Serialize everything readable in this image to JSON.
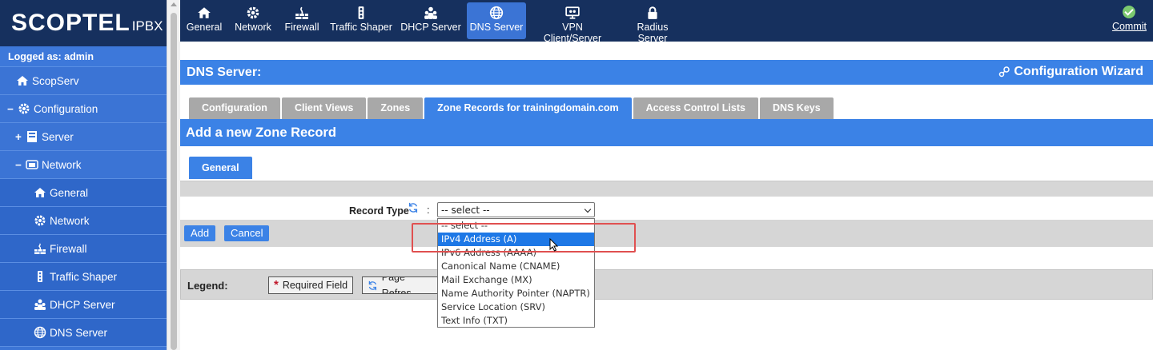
{
  "brand": {
    "name": "SCOPTEL",
    "suffix": "IPBX"
  },
  "sidebar": {
    "logged": "Logged as: admin",
    "items": [
      {
        "label": "ScopServ",
        "icon": "home-icon",
        "pm": ""
      },
      {
        "label": "Configuration",
        "icon": "gear-icon",
        "pm": "−"
      },
      {
        "label": "Server",
        "icon": "server-icon",
        "pm": "+"
      },
      {
        "label": "Network",
        "icon": "network-icon",
        "pm": "−"
      },
      {
        "label": "General",
        "icon": "home-icon",
        "pm": ""
      },
      {
        "label": "Network",
        "icon": "gear-icon",
        "pm": ""
      },
      {
        "label": "Firewall",
        "icon": "firewall-icon",
        "pm": ""
      },
      {
        "label": "Traffic Shaper",
        "icon": "traffic-icon",
        "pm": ""
      },
      {
        "label": "DHCP Server",
        "icon": "users-icon",
        "pm": ""
      },
      {
        "label": "DNS Server",
        "icon": "globe-icon",
        "pm": ""
      }
    ]
  },
  "topbar": {
    "items": [
      {
        "label": "General",
        "icon": "home-icon"
      },
      {
        "label": "Network",
        "icon": "gear-icon"
      },
      {
        "label": "Firewall",
        "icon": "firewall-icon"
      },
      {
        "label": "Traffic Shaper",
        "icon": "traffic-icon"
      },
      {
        "label": "DHCP Server",
        "icon": "users-icon"
      },
      {
        "label": "DNS Server",
        "icon": "globe-icon",
        "active": true
      },
      {
        "label": "VPN Client/Server",
        "icon": "vpn-icon"
      },
      {
        "label": "Radius Server",
        "icon": "lock-icon"
      }
    ],
    "commit": "Commit"
  },
  "page": {
    "title": "DNS Server:",
    "wizard": "Configuration Wizard",
    "tabs": [
      "Configuration",
      "Client Views",
      "Zones",
      "Zone Records for trainingdomain.com",
      "Access Control Lists",
      "DNS Keys"
    ],
    "section_title": "Add a new Zone Record",
    "subtab": "General",
    "record_type_label": "Record Type",
    "colon": ":",
    "select_value": "-- select --",
    "add": "Add",
    "cancel": "Cancel",
    "legend_label": "Legend:",
    "legend_required": "Required Field",
    "legend_refresh": "Page Refres",
    "dropdown_options": [
      "-- select --",
      "IPv4 Address (A)",
      "IPv6 Address (AAAA)",
      "Canonical Name (CNAME)",
      "Mail Exchange (MX)",
      "Name Authority Pointer (NAPTR)",
      "Service Location (SRV)",
      "Text Info (TXT)"
    ]
  }
}
